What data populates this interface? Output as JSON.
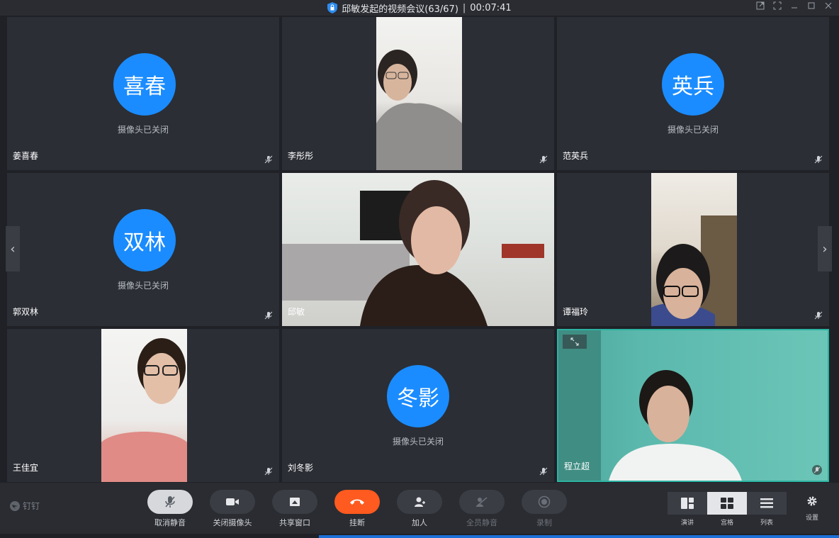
{
  "window": {
    "title": "邱敏发起的视频会议(63/67)",
    "separator": "|",
    "timer": "00:07:41"
  },
  "participants": [
    {
      "name": "姜喜春",
      "avatar": "喜春",
      "camera_status": "摄像头已关闭"
    },
    {
      "name": "李彤彤"
    },
    {
      "name": "范英兵",
      "avatar": "英兵",
      "camera_status": "摄像头已关闭"
    },
    {
      "name": "郭双林",
      "avatar": "双林",
      "camera_status": "摄像头已关闭"
    },
    {
      "name": "邱敏"
    },
    {
      "name": "谭福玲"
    },
    {
      "name": "王佳宜"
    },
    {
      "name": "刘冬影",
      "avatar": "冬影",
      "camera_status": "摄像头已关闭"
    },
    {
      "name": "程立超"
    }
  ],
  "brand": "钉钉",
  "controls": [
    {
      "label": "取消静音",
      "icon": "mic-icon"
    },
    {
      "label": "关闭摄像头",
      "icon": "camera-icon"
    },
    {
      "label": "共享窗口",
      "icon": "share-icon"
    },
    {
      "label": "挂断",
      "icon": "hangup-icon"
    },
    {
      "label": "加人",
      "icon": "add-user-icon"
    },
    {
      "label": "全员静音",
      "icon": "mute-all-icon"
    },
    {
      "label": "录制",
      "icon": "record-icon"
    }
  ],
  "views": [
    {
      "label": "演讲",
      "active": false
    },
    {
      "label": "宫格",
      "active": true
    },
    {
      "label": "列表",
      "active": false
    }
  ],
  "settings_label": "设置",
  "colors": {
    "avatar": "#1a8cff",
    "hangup": "#ff5a1f",
    "tile": "#2b2e35"
  }
}
